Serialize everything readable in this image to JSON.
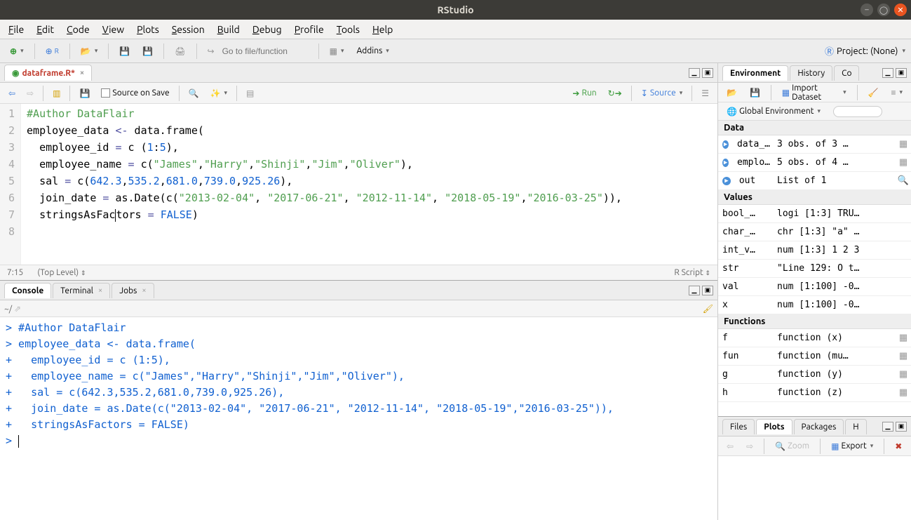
{
  "window": {
    "title": "RStudio"
  },
  "menubar": [
    "File",
    "Edit",
    "Code",
    "View",
    "Plots",
    "Session",
    "Build",
    "Debug",
    "Profile",
    "Tools",
    "Help"
  ],
  "toolbar": {
    "goto_placeholder": "Go to file/function",
    "addins": "Addins",
    "project_label": "Project: (None)"
  },
  "source": {
    "tab": "dataframe.R*",
    "source_on_save": "Source on Save",
    "run": "Run",
    "source_btn": "Source",
    "cursor_pos": "7:15",
    "scope": "(Top Level)",
    "lang": "R Script",
    "lines": [
      "#Author DataFlair",
      "employee_data <- data.frame(",
      "  employee_id = c (1:5),",
      "  employee_name = c(\"James\",\"Harry\",\"Shinji\",\"Jim\",\"Oliver\"),",
      "  sal = c(642.3,535.2,681.0,739.0,925.26),",
      "  join_date = as.Date(c(\"2013-02-04\", \"2017-06-21\", \"2012-11-14\", \"2018-05-19\",\"2016-03-25\")),",
      "  stringsAsFactors = FALSE)",
      ""
    ]
  },
  "console": {
    "tab1": "Console",
    "tab2": "Terminal",
    "tab3": "Jobs",
    "cwd": "~/",
    "lines": [
      "> #Author DataFlair",
      "> employee_data <- data.frame(",
      "+   employee_id = c (1:5),",
      "+   employee_name = c(\"James\",\"Harry\",\"Shinji\",\"Jim\",\"Oliver\"),",
      "+   sal = c(642.3,535.2,681.0,739.0,925.26),",
      "+   join_date = as.Date(c(\"2013-02-04\", \"2017-06-21\", \"2012-11-14\", \"2018-05-19\",\"2016-03-25\")),",
      "+   stringsAsFactors = FALSE)",
      "> "
    ]
  },
  "env": {
    "tabs": [
      "Environment",
      "History",
      "Co"
    ],
    "import": "Import Dataset",
    "scope": "Global Environment",
    "sections": {
      "Data": [
        {
          "name": "data_…",
          "val": "3 obs. of 3 …",
          "icon": true,
          "act": "▦"
        },
        {
          "name": "emplo…",
          "val": "5 obs. of 4 …",
          "icon": true,
          "act": "▦"
        },
        {
          "name": "out",
          "val": "List of 1",
          "icon": true,
          "act": "🔍"
        }
      ],
      "Values": [
        {
          "name": "bool_…",
          "val": "logi [1:3] TRU…"
        },
        {
          "name": "char_…",
          "val": "chr [1:3] \"a\" …"
        },
        {
          "name": "int_v…",
          "val": "num [1:3] 1 2 3"
        },
        {
          "name": "str",
          "val": "\"Line 129: O t…"
        },
        {
          "name": "val",
          "val": "num [1:100] -0…"
        },
        {
          "name": "x",
          "val": "num [1:100] -0…"
        }
      ],
      "Functions": [
        {
          "name": "f",
          "val": "function (x)",
          "act": "▦"
        },
        {
          "name": "fun",
          "val": "function (mu…",
          "act": "▦"
        },
        {
          "name": "g",
          "val": "function (y)",
          "act": "▦"
        },
        {
          "name": "h",
          "val": "function (z)",
          "act": "▦"
        }
      ]
    }
  },
  "plots": {
    "tabs": [
      "Files",
      "Plots",
      "Packages",
      "H"
    ],
    "zoom": "Zoom",
    "export": "Export"
  }
}
